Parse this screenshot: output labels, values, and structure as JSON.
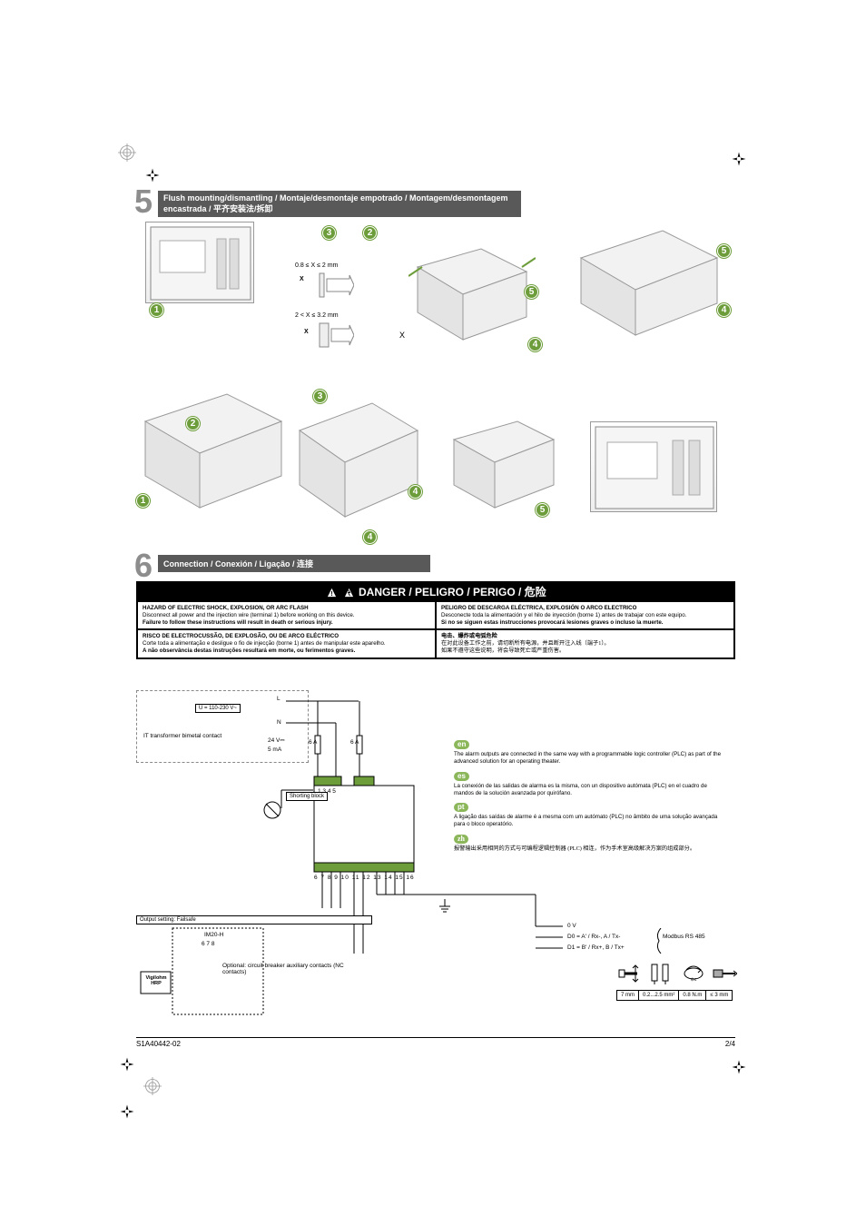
{
  "section5": {
    "number": "5",
    "title": "Flush mounting/dismantling / Montaje/desmontaje empotrado / Montagem/desmontagem encastrada / 平齐安装法/拆卸"
  },
  "thickness": {
    "range1": "0.8 ≤ X ≤ 2 mm",
    "range2": "2 < X ≤ 3.2 mm",
    "var1": "X",
    "var2": "X"
  },
  "bubbles": {
    "b1": "1",
    "b2": "2",
    "b3": "3",
    "b4": "4",
    "b5": "5"
  },
  "section6": {
    "number": "6",
    "title": "Connection / Conexión / Ligação / 连接"
  },
  "danger": {
    "heading": "DANGER / PELIGRO / PERIGO / 危险",
    "en_title": "HAZARD OF ELECTRIC SHOCK, EXPLOSION, OR ARC FLASH",
    "en_body": "Disconnect all power and the injection wire (terminal 1) before working on this device.",
    "en_footer": "Failure to follow these instructions will result in death or serious injury.",
    "es_title": "PELIGRO DE DESCARGA ELÉCTRICA, EXPLOSIÓN O ARCO ELECTRICO",
    "es_body": "Desconecte toda la alimentación y el hilo de inyección (borne 1) antes de trabajar con este equipo.",
    "es_footer": "Si no se siguen estas instrucciones provocará lesiones graves o incluso la muerte.",
    "pt_title": "RISCO DE ELECTROCUSSÃO, DE EXPLOSÃO, OU DE ARCO ELÉCTRICO",
    "pt_body": "Corte toda a alimentação e desligue o fio de injecção (borne 1) antes de manipular este aparelho.",
    "pt_footer": "A não observância destas instruções resultará em morte, ou ferimentos graves.",
    "zh_title": "电击、爆炸或电弧危险",
    "zh_body": "在对此设备工作之前，请切断所有电源，并且断开注入线（端子1）。",
    "zh_footer": "如果不遵守这些说明，将会导致死亡或严重伤害。"
  },
  "diagram": {
    "voltage_label": "U = 110-230 V~",
    "supply_L": "L",
    "supply_N": "N",
    "bimetal": "IT transformer bimetal contact",
    "aux_supply": "24 V⎓",
    "aux_current": "5 mA",
    "fuse": "6 A",
    "shorting": "Shorting block",
    "output_setting": "Output setting: Failsafe",
    "module": "IM20-H",
    "terminals_small": "6    7    8",
    "optional_contacts": "Optional: circuit breaker auxiliary contacts (NC contacts)",
    "vigilohm": "Vigilohm HRP",
    "term_row": "6  7  8     9 10   11 12 13 14   15 16",
    "top_terms": "1     3                4  5",
    "zero_v": "0 V",
    "d0": "D0 = A' / Rx-, A / Tx-",
    "d1": "D1 = B' / Rx+, B / Tx+",
    "modbus": "Modbus RS 485"
  },
  "notes": {
    "en_badge": "en",
    "en": "The alarm outputs are connected in the same way with a programmable logic controller (PLC) as part of the advanced solution for an operating theater.",
    "es_badge": "es",
    "es": "La conexión de las salidas de alarma es la misma, con un dispositivo autómata (PLC) en el cuadro de mandos de la solución avanzada por quirófano.",
    "pt_badge": "pt",
    "pt": "A ligação das saídas de alarme é a mesma com um autómato (PLC) no âmbito de uma solução avançada para o bloco operatório.",
    "zh_badge": "zh",
    "zh": "报警输出采用相同的方式与可编程逻辑控制器 (PLC) 相连，作为手术室高级解决方案的组成部分。"
  },
  "wire": {
    "len": "7 mm",
    "area": "0.2...2.5 mm²",
    "torque": "0.8 N.m",
    "screw": "≤ 3 mm"
  },
  "footer": {
    "doc": "S1A40442-02",
    "page": "2/4"
  }
}
